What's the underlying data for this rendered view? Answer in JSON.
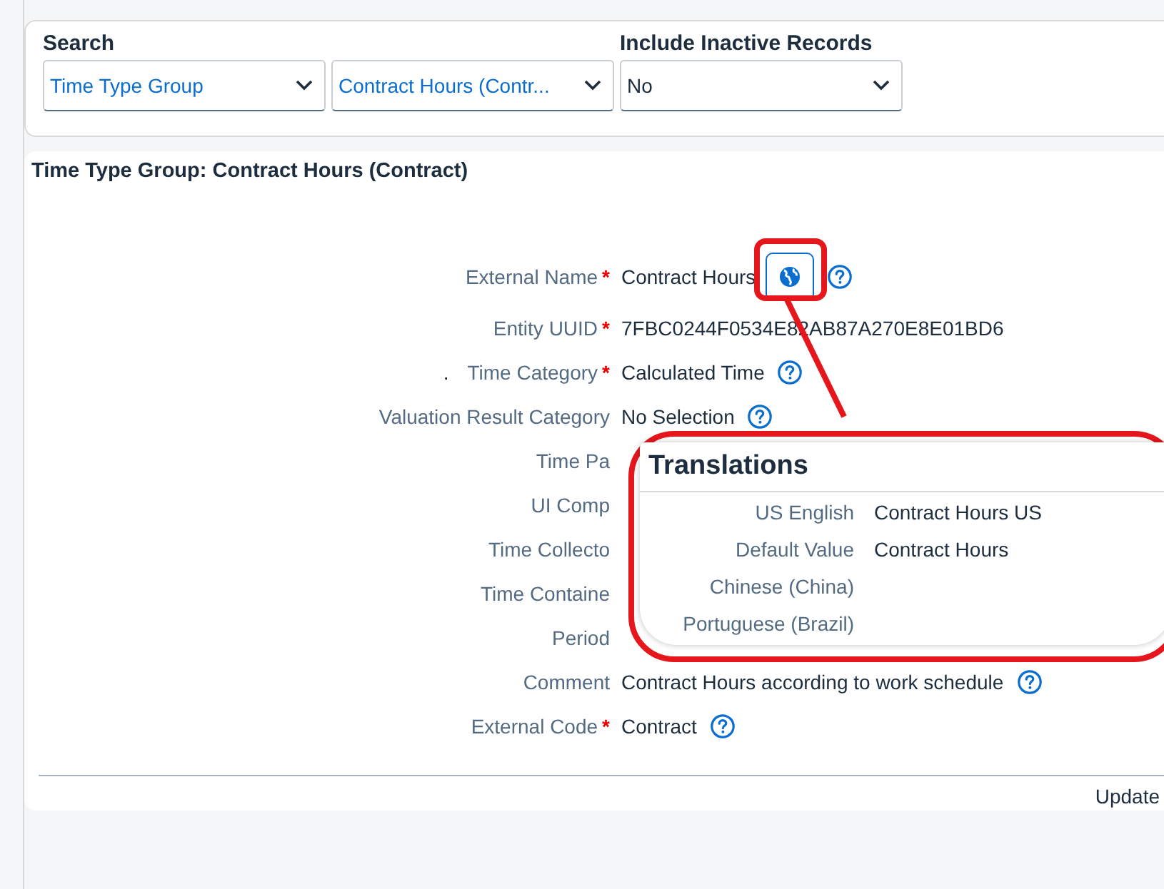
{
  "search": {
    "title": "Search",
    "selects": [
      {
        "value": "Time Type Group",
        "kind": "entity"
      },
      {
        "value": "Contract Hours (Contr...",
        "kind": "entity"
      }
    ]
  },
  "inactive": {
    "label": "Include Inactive Records",
    "value": "No",
    "kind": "option"
  },
  "detail": {
    "title": "Time Type Group: Contract Hours (Contract)",
    "fields": [
      {
        "label": "External Name",
        "required_mark": "*",
        "value": "Contract Hours",
        "translate": true,
        "help": true
      },
      {
        "label": "Entity UUID",
        "required_mark": "*",
        "value": "7FBC0244F0534E82AB87A270E8E01BD6"
      },
      {
        "prefix": ".",
        "label": "Time Category",
        "required_mark": "*",
        "value": "Calculated Time",
        "help": true
      },
      {
        "label": "Valuation Result Category",
        "value": "No Selection",
        "help": true
      },
      {
        "label": "Time Pa"
      },
      {
        "label": "UI Comp"
      },
      {
        "label": "Time Collecto"
      },
      {
        "label": "Time Containe"
      },
      {
        "label": "Period"
      },
      {
        "label": "Comment",
        "value": "Contract Hours according to work schedule",
        "help": true
      },
      {
        "label": "External Code",
        "required_mark": "*",
        "value": "Contract",
        "help": true
      }
    ],
    "footer": "Update"
  },
  "popover": {
    "title": "Translations",
    "rows": [
      {
        "language": "US English",
        "value": "Contract Hours US"
      },
      {
        "language": "Default Value",
        "value": "Contract Hours"
      },
      {
        "language": "Chinese (China)"
      },
      {
        "language": "Portuguese (Brazil)"
      }
    ]
  }
}
